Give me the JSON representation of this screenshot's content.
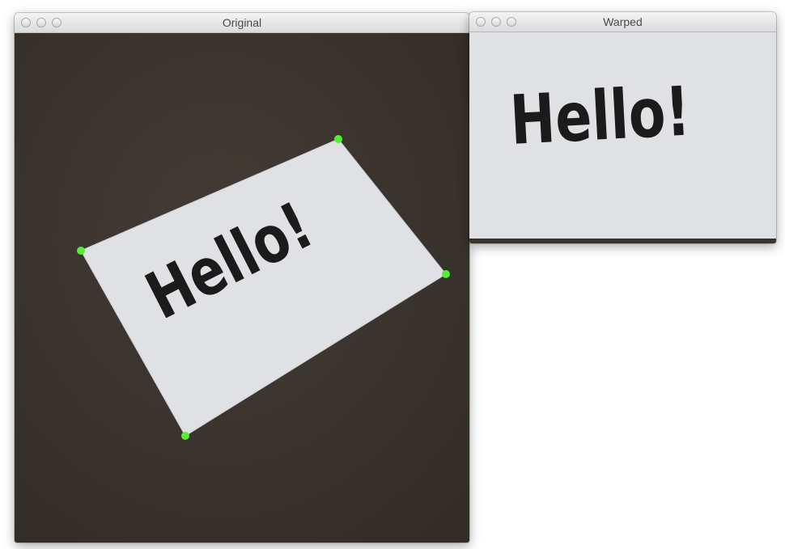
{
  "windows": {
    "original": {
      "title": "Original",
      "note_text": "Hello!",
      "corner_marker_color": "#55ee33"
    },
    "warped": {
      "title": "Warped",
      "note_text": "Hello!"
    }
  },
  "colors": {
    "table_surface": "#3f3933",
    "paper": "#dfe1e5",
    "ink": "#1b1b1b"
  }
}
